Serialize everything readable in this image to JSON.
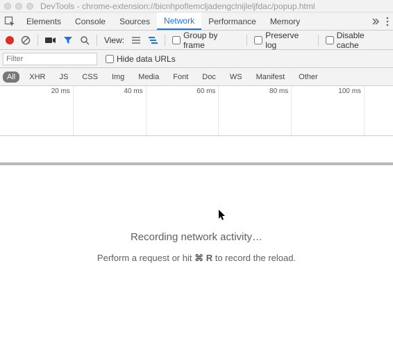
{
  "window": {
    "title": "DevTools - chrome-extension://bicnhpoflemcljadengclnijleljfdac/popup.html"
  },
  "tabs": {
    "items": [
      {
        "label": "Elements"
      },
      {
        "label": "Console"
      },
      {
        "label": "Sources"
      },
      {
        "label": "Network"
      },
      {
        "label": "Performance"
      },
      {
        "label": "Memory"
      }
    ],
    "active_index": 3
  },
  "toolbar": {
    "view_label": "View:",
    "group_by_frame": "Group by frame",
    "preserve_log": "Preserve log",
    "disable_cache": "Disable cache"
  },
  "filterbar": {
    "placeholder": "Filter",
    "hide_data_urls": "Hide data URLs"
  },
  "types": {
    "items": [
      {
        "label": "All"
      },
      {
        "label": "XHR"
      },
      {
        "label": "JS"
      },
      {
        "label": "CSS"
      },
      {
        "label": "Img"
      },
      {
        "label": "Media"
      },
      {
        "label": "Font"
      },
      {
        "label": "Doc"
      },
      {
        "label": "WS"
      },
      {
        "label": "Manifest"
      },
      {
        "label": "Other"
      }
    ],
    "active_index": 0
  },
  "timeline": {
    "ticks": [
      "20 ms",
      "40 ms",
      "60 ms",
      "80 ms",
      "100 ms"
    ]
  },
  "empty_state": {
    "primary": "Recording network activity…",
    "secondary_before": "Perform a request or hit ",
    "secondary_kbd": "⌘ R",
    "secondary_after": " to record the reload."
  }
}
